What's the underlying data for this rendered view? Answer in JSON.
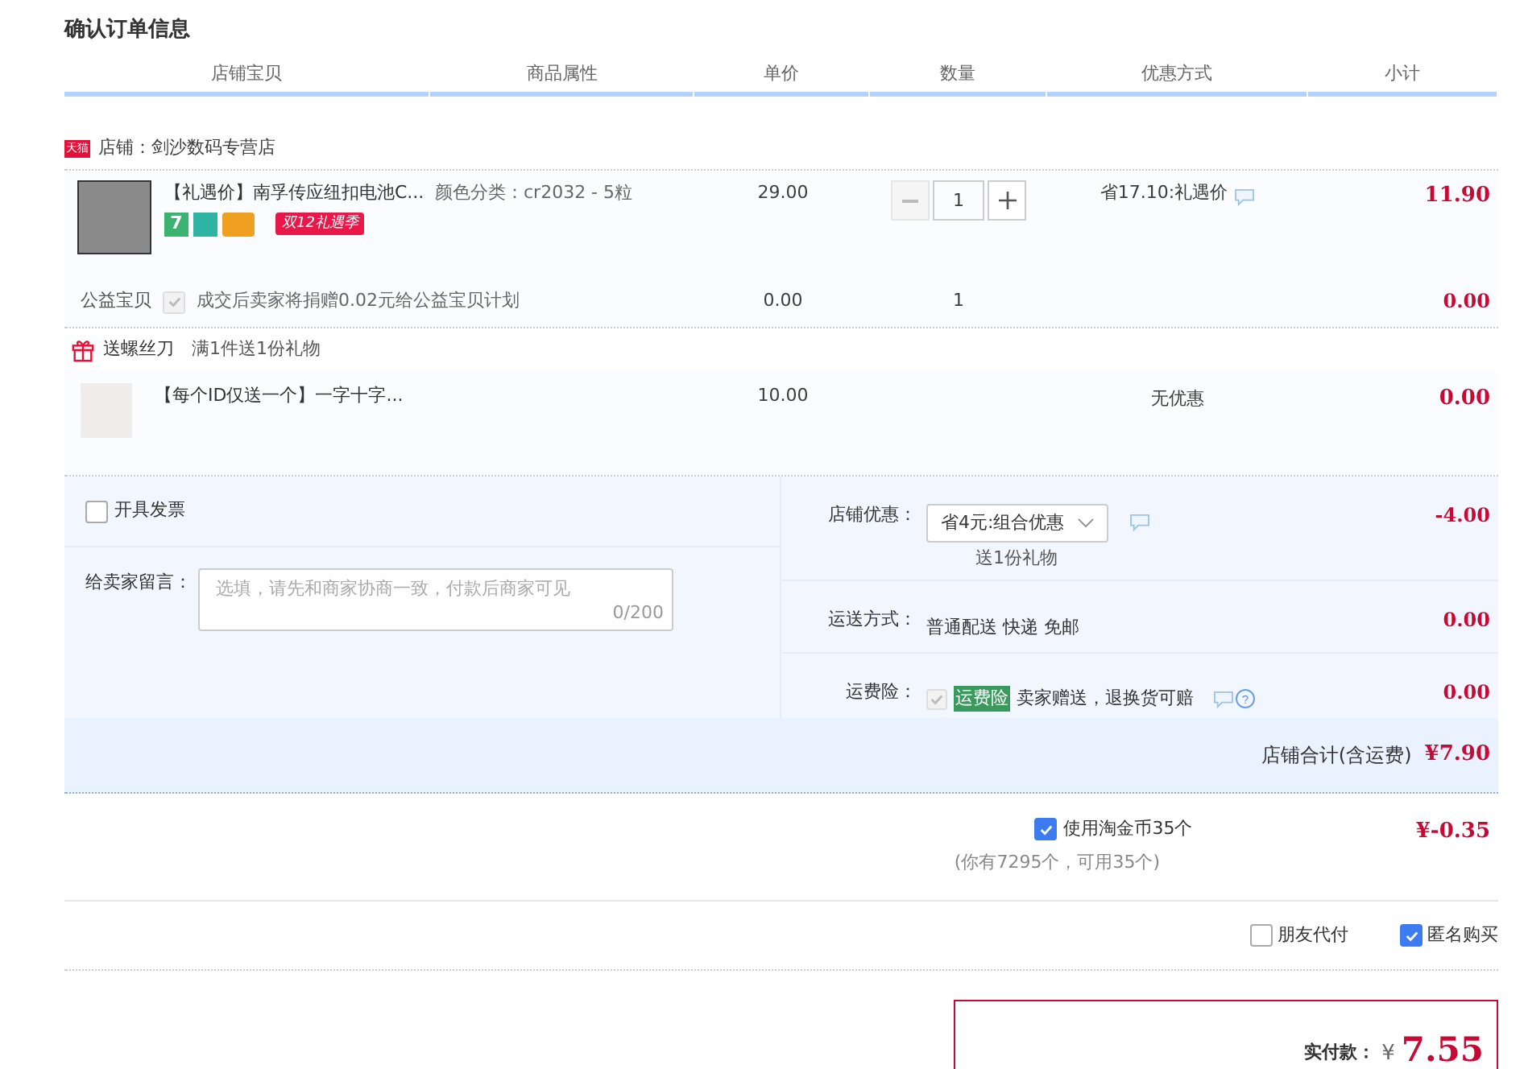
{
  "page_title": "确认订单信息",
  "columns": [
    "店铺宝贝",
    "商品属性",
    "单价",
    "数量",
    "优惠方式",
    "小计"
  ],
  "shop": {
    "badge": "天猫",
    "name": "店铺：剑沙数码专营店"
  },
  "item": {
    "title": "【礼遇价】南孚传应纽扣电池C...",
    "tags": [
      {
        "kind": "tile",
        "label": "7",
        "color": "#3cb371"
      },
      {
        "kind": "tile",
        "color": "#2fb3a3"
      },
      {
        "kind": "card",
        "color": "#f0a020"
      },
      {
        "kind": "promo",
        "label": "双12礼遇季",
        "color": "#e8184a"
      }
    ],
    "attribute": "颜色分类：cr2032 - 5粒",
    "price": "29.00",
    "quantity": "1",
    "discount": "省17.10:礼遇价",
    "subtotal": "11.90"
  },
  "charity": {
    "label": "公益宝贝",
    "checked": true,
    "disabled": true,
    "text": "成交后卖家将捐赠0.02元给公益宝贝计划",
    "price": "0.00",
    "quantity": "1",
    "subtotal": "0.00"
  },
  "gift": {
    "name": "送螺丝刀",
    "rule": "满1件送1份礼物",
    "title": "【每个ID仅送一个】一字十字...",
    "price": "10.00",
    "discount": "无优惠",
    "subtotal": "0.00"
  },
  "invoice": {
    "label": "开具发票",
    "checked": false
  },
  "message": {
    "label": "给卖家留言：",
    "placeholder": "选填，请先和商家协商一致，付款后商家可见",
    "counter": "0/200"
  },
  "shop_discount": {
    "label": "店铺优惠：",
    "value": "省4元:组合优惠",
    "note": "送1份礼物",
    "amount": "-4.00"
  },
  "shipping": {
    "label": "运送方式：",
    "value": "普通配送 快递 免邮",
    "amount": "0.00"
  },
  "insurance": {
    "label": "运费险：",
    "checked": true,
    "disabled": true,
    "badge": "运费险",
    "text": "卖家赠送，退换货可赔",
    "amount": "0.00"
  },
  "shop_total": {
    "label": "店铺合计(含运费)",
    "amount": "¥7.90"
  },
  "coins": {
    "label": "使用淘金币35个",
    "checked": true,
    "note": "(你有7295个，可用35个)",
    "amount": "¥-0.35"
  },
  "options": [
    {
      "label": "朋友代付",
      "checked": false
    },
    {
      "label": "匿名购买",
      "checked": true
    }
  ],
  "payment": {
    "label": "实付款：",
    "currency": "¥",
    "amount": "7.55"
  }
}
